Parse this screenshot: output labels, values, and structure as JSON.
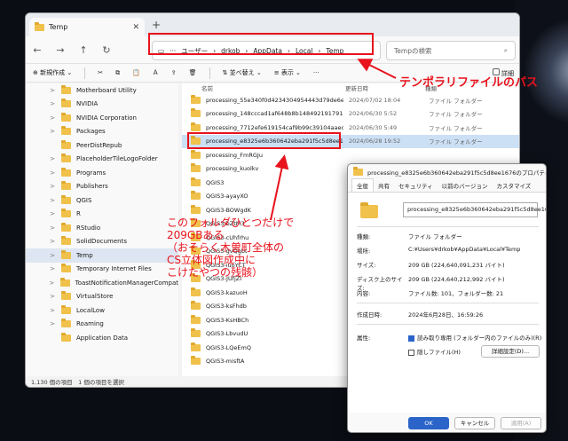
{
  "window": {
    "tab_title": "Temp",
    "breadcrumb": [
      "ユーザー",
      "drkob",
      "AppData",
      "Local",
      "Temp"
    ],
    "search_placeholder": "Tempの検索",
    "toolbar": {
      "new_label": "新規作成",
      "sort_label": "並べ替え",
      "view_label": "表示",
      "details_label": "詳細"
    },
    "sidebar": [
      {
        "label": "Motherboard Utility",
        "chev": ">"
      },
      {
        "label": "NVIDIA",
        "chev": ">"
      },
      {
        "label": "NVIDIA Corporation",
        "chev": ">"
      },
      {
        "label": "Packages",
        "chev": ">"
      },
      {
        "label": "PeerDistRepub",
        "chev": ""
      },
      {
        "label": "PlaceholderTileLogoFolder",
        "chev": ">"
      },
      {
        "label": "Programs",
        "chev": ">"
      },
      {
        "label": "Publishers",
        "chev": ">"
      },
      {
        "label": "QGIS",
        "chev": ">"
      },
      {
        "label": "R",
        "chev": ">"
      },
      {
        "label": "RStudio",
        "chev": ">"
      },
      {
        "label": "SolidDocuments",
        "chev": ">"
      },
      {
        "label": "Temp",
        "chev": ">"
      },
      {
        "label": "Temporary Internet Files",
        "chev": ">"
      },
      {
        "label": "ToastNotificationManagerCompat",
        "chev": ">"
      },
      {
        "label": "VirtualStore",
        "chev": ">"
      },
      {
        "label": "LocalLow",
        "chev": ">"
      },
      {
        "label": "Roaming",
        "chev": ">"
      },
      {
        "label": "Application Data",
        "chev": ""
      }
    ],
    "columns": {
      "name": "名前",
      "date": "更新日時",
      "type": "種類"
    },
    "files": [
      {
        "name": "processing_55e340f0d4234304954443d79de6edd",
        "date": "2024/07/02 18:04",
        "type": "ファイル フォルダー"
      },
      {
        "name": "processing_148cccad1af648b8b1484921917913c",
        "date": "2024/06/30 5:52",
        "type": "ファイル フォルダー"
      },
      {
        "name": "processing_7712efe619154caf9b99c39104aaedec",
        "date": "2024/06/30 5:49",
        "type": "ファイル フォルダー"
      },
      {
        "name": "processing_e8325e6b360642eba291f5c5d8ee1676",
        "date": "2024/06/28 19:52",
        "type": "ファイル フォルダー"
      },
      {
        "name": "processing_FmRGJu",
        "date": "",
        "type": ""
      },
      {
        "name": "processing_kuolkv",
        "date": "",
        "type": ""
      },
      {
        "name": "QGIS3",
        "date": "",
        "type": ""
      },
      {
        "name": "QGIS3-ayayXO",
        "date": "",
        "type": ""
      },
      {
        "name": "QGIS3-BOWgdK",
        "date": "",
        "type": ""
      },
      {
        "name": "QGIS3-bZtM3",
        "date": "",
        "type": ""
      },
      {
        "name": "QGIS3-cUhfrhu",
        "date": "",
        "type": ""
      },
      {
        "name": "QGIS3-gvQgbt",
        "date": "",
        "type": ""
      },
      {
        "name": "QGIS3-iuoYCT",
        "date": "",
        "type": ""
      },
      {
        "name": "QGIS3-JUfjZI",
        "date": "",
        "type": ""
      },
      {
        "name": "QGIS3-kazuoH",
        "date": "",
        "type": ""
      },
      {
        "name": "QGIS3-ksFhdb",
        "date": "",
        "type": ""
      },
      {
        "name": "QGIS3-KsHBCh",
        "date": "",
        "type": ""
      },
      {
        "name": "QGIS3-LbvudU",
        "date": "",
        "type": ""
      },
      {
        "name": "QGIS3-LQeEmQ",
        "date": "",
        "type": ""
      },
      {
        "name": "QGIS3-misftA",
        "date": "",
        "type": ""
      }
    ],
    "status": "1,130 個の項目　1 個の項目を選択"
  },
  "annotations": {
    "temp_path": "テンポラリファイルのパス",
    "folder_note_lines": [
      "このフォルダひとつだけで",
      "209GBある",
      "（おそらく木曽町全体の",
      "CS立体図作成中に",
      "こけたやつの残骸）"
    ],
    "accent_color": "#e8121c"
  },
  "dialog": {
    "title": "processing_e8325e6b360642eba291f5c5d8ee1676のプロパティ",
    "tabs": [
      "全般",
      "共有",
      "セキュリティ",
      "以前のバージョン",
      "カスタマイズ"
    ],
    "name": "processing_e8325e6b360642eba291f5c5d8ee1676",
    "type_label": "種類:",
    "type_value": "ファイル フォルダー",
    "location_label": "場所:",
    "location_value": "C:¥Users¥drkob¥AppData¥Local¥Temp",
    "size_label": "サイズ:",
    "size_value_hl": "209 GB",
    "size_value_rest": "(224,640,091,231 バイト)",
    "disk_size_label": "ディスク上のサイズ:",
    "disk_size_value": "209 GB (224,640,212,992 バイト)",
    "contents_label": "内容:",
    "contents_value": "ファイル数: 101、フォルダー数: 21",
    "created_label": "作成日時:",
    "created_value": "2024年6月28日、16:59:26",
    "attr_label": "属性:",
    "readonly_label": "読み取り専用 (フォルダー内のファイルのみ)(R)",
    "hidden_label": "隠しファイル(H)",
    "advanced_label": "詳細設定(D)...",
    "ok_label": "OK",
    "cancel_label": "キャンセル",
    "apply_label": "適用(A)"
  }
}
